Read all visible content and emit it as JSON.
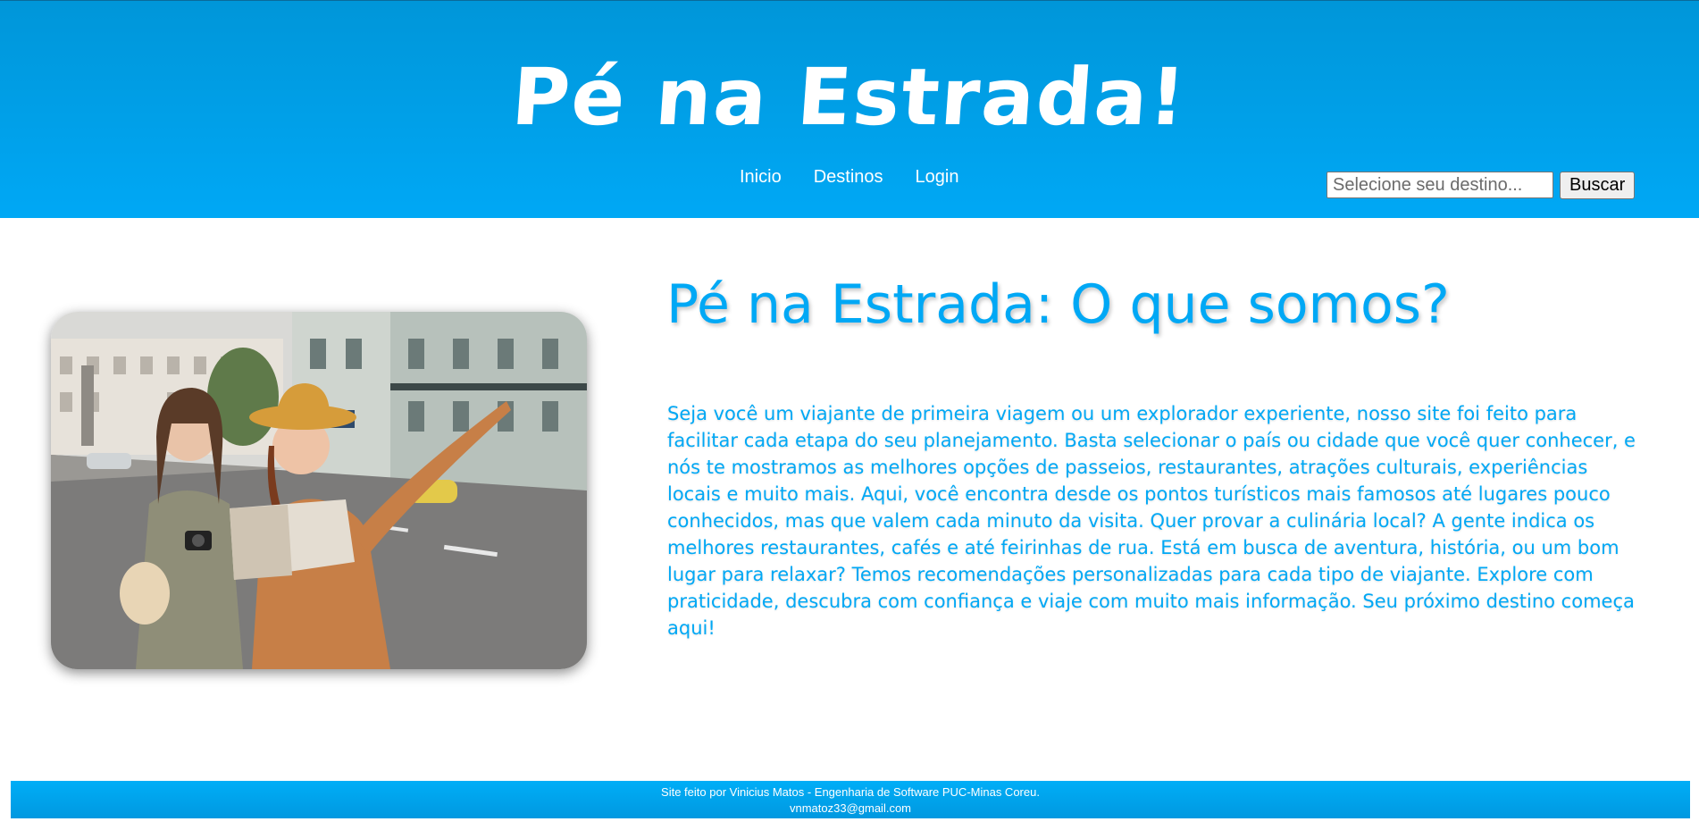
{
  "header": {
    "title": "Pé na Estrada!",
    "nav": [
      "Inicio",
      "Destinos",
      "Login"
    ],
    "search": {
      "placeholder": "Selecione seu destino...",
      "value": "",
      "button_label": "Buscar"
    }
  },
  "main": {
    "image_icon": "travelers-photo",
    "heading": "Pé na Estrada: O que somos?",
    "paragraph": "Seja você um viajante de primeira viagem ou um explorador experiente, nosso site foi feito para facilitar cada etapa do seu planejamento. Basta selecionar o país ou cidade que você quer conhecer, e nós te mostramos as melhores opções de passeios, restaurantes, atrações culturais, experiências locais e muito mais. Aqui, você encontra desde os pontos turísticos mais famosos até lugares pouco conhecidos, mas que valem cada minuto da visita. Quer provar a culinária local? A gente indica os melhores restaurantes, cafés e até feirinhas de rua. Está em busca de aventura, história, ou um bom lugar para relaxar? Temos recomendações personalizadas para cada tipo de viajante. Explore com praticidade, descubra com confiança e viaje com muito mais informação. Seu próximo destino começa aqui!"
  },
  "footer": {
    "credit": "Site feito por Vinicius Matos - Engenharia de Software PUC-Minas Coreu.",
    "email": "vnmatoz33@gmail.com"
  },
  "colors": {
    "brand_blue": "#00a8f5",
    "header_top": "#0096d9"
  }
}
